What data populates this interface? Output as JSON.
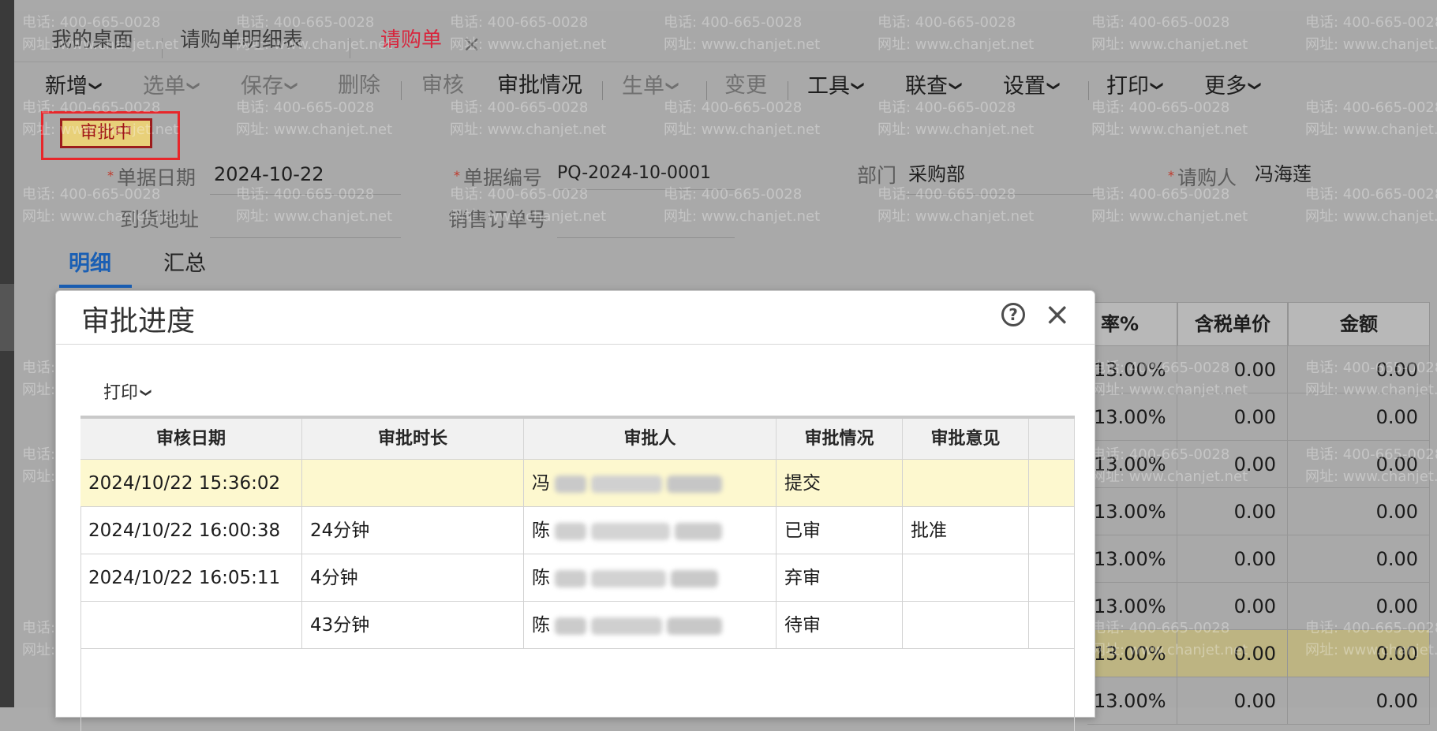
{
  "tabs": [
    {
      "label": "我的桌面"
    },
    {
      "label": "请购单明细表"
    },
    {
      "label": "请购单",
      "active": true,
      "close": "×"
    }
  ],
  "toolbar": {
    "add": "新增",
    "select": "选单",
    "save": "保存",
    "delete": "删除",
    "audit": "审核",
    "approval_status": "审批情况",
    "generate": "生单",
    "change": "变更",
    "tools": "工具",
    "query": "联查",
    "settings": "设置",
    "print": "打印",
    "more": "更多"
  },
  "status_badge": "审批中",
  "form": {
    "doc_date_label": "单据日期",
    "doc_date": "2024-10-22",
    "doc_no_label": "单据编号",
    "doc_no": "PQ-2024-10-0001",
    "dept_label": "部门",
    "dept": "采购部",
    "requester_label": "请购人",
    "requester": "冯海莲",
    "address_label": "到货地址",
    "sales_order_label": "销售订单号",
    "required_mark": "*"
  },
  "subtabs": [
    {
      "label": "明细",
      "active": true
    },
    {
      "label": "汇总"
    }
  ],
  "background_grid": {
    "headers": [
      "率%",
      "含税单价",
      "金额"
    ],
    "rows": [
      [
        "13.00%",
        "0.00",
        "0.00"
      ],
      [
        "13.00%",
        "0.00",
        "0.00"
      ],
      [
        "13.00%",
        "0.00",
        "0.00"
      ],
      [
        "13.00%",
        "0.00",
        "0.00"
      ],
      [
        "13.00%",
        "0.00",
        "0.00"
      ],
      [
        "13.00%",
        "0.00",
        "0.00"
      ],
      [
        "13.00%",
        "0.00",
        "0.00"
      ],
      [
        "13.00%",
        "0.00",
        "0.00"
      ]
    ]
  },
  "watermark": {
    "phone": "电话: 400-665-0028",
    "site": "网址: www.chanjet.net"
  },
  "dialog": {
    "title": "审批进度",
    "help_icon": "?",
    "close_icon": "×",
    "print": "打印",
    "columns": [
      "审核日期",
      "审批时长",
      "审批人",
      "审批情况",
      "审批意见"
    ],
    "rows": [
      {
        "date": "2024/10/22 15:36:02",
        "duration": "",
        "approver": "冯",
        "status": "提交",
        "opinion": ""
      },
      {
        "date": "2024/10/22 16:00:38",
        "duration": "24分钟",
        "approver": "陈",
        "status": "已审",
        "opinion": "批准"
      },
      {
        "date": "2024/10/22 16:05:11",
        "duration": "4分钟",
        "approver": "陈",
        "status": "弃审",
        "opinion": ""
      },
      {
        "date": "",
        "duration": "43分钟",
        "approver": "陈",
        "status": "待审",
        "opinion": ""
      }
    ]
  },
  "colors": {
    "active_tab": "#d7263d",
    "stamp_bg": "#e8d079",
    "highlight_row": "#fdf8cf",
    "subtab_active": "#1a5fb4"
  }
}
